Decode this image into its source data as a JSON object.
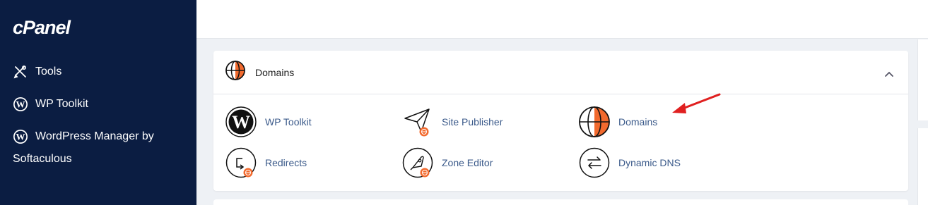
{
  "brand": {
    "logo": "cPanel"
  },
  "sidebar": {
    "items": [
      {
        "label": "Tools",
        "icon": "tools-icon"
      },
      {
        "label": "WP Toolkit",
        "icon": "wordpress-icon"
      },
      {
        "label": "WordPress Manager by Softaculous",
        "icon": "wordpress-icon"
      }
    ]
  },
  "section": {
    "title": "Domains",
    "icon": "globe-icon",
    "collapse_icon": "chevron-up-icon"
  },
  "tools": [
    {
      "label": "WP Toolkit",
      "icon": "wordpress-icon"
    },
    {
      "label": "Site Publisher",
      "icon": "paper-plane-icon"
    },
    {
      "label": "Domains",
      "icon": "globe-icon"
    },
    {
      "label": "Redirects",
      "icon": "redirect-icon"
    },
    {
      "label": "Zone Editor",
      "icon": "rocket-icon"
    },
    {
      "label": "Dynamic DNS",
      "icon": "exchange-arrows-icon"
    }
  ],
  "colors": {
    "sidebar_bg": "#0b1d42",
    "accent_orange": "#f26a2e",
    "link": "#3b5a8a",
    "annotation_arrow": "#e02020"
  }
}
